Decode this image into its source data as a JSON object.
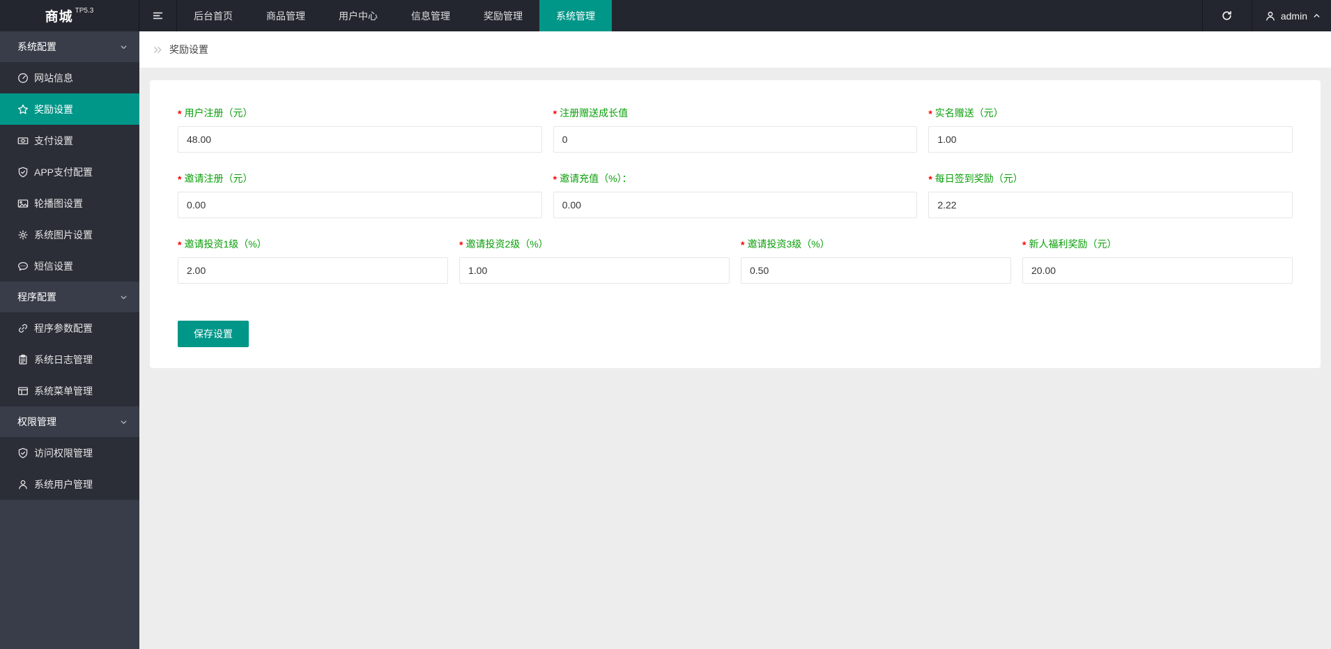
{
  "colors": {
    "accent": "#009688",
    "label_green": "#0a9f0a",
    "asterisk_red": "#ff0000"
  },
  "topbar": {
    "logo": "商城",
    "logo_version": "TP5.3",
    "nav": [
      {
        "label": "后台首页"
      },
      {
        "label": "商品管理"
      },
      {
        "label": "用户中心"
      },
      {
        "label": "信息管理"
      },
      {
        "label": "奖励管理"
      },
      {
        "label": "系统管理",
        "active": true
      }
    ],
    "username": "admin"
  },
  "breadcrumb": {
    "current": "奖励设置"
  },
  "sidebar": {
    "sections": [
      {
        "title": "系统配置",
        "items": [
          {
            "label": "网站信息",
            "icon": "gauge-icon"
          },
          {
            "label": "奖励设置",
            "icon": "star-icon",
            "active": true
          },
          {
            "label": "支付设置",
            "icon": "banknote-icon"
          },
          {
            "label": "APP支付配置",
            "icon": "shield-check-icon"
          },
          {
            "label": "轮播图设置",
            "icon": "image-icon"
          },
          {
            "label": "系统图片设置",
            "icon": "gear-icon"
          },
          {
            "label": "短信设置",
            "icon": "message-icon"
          }
        ]
      },
      {
        "title": "程序配置",
        "items": [
          {
            "label": "程序参数配置",
            "icon": "link-icon"
          },
          {
            "label": "系统日志管理",
            "icon": "clipboard-icon"
          },
          {
            "label": "系统菜单管理",
            "icon": "layout-icon"
          }
        ]
      },
      {
        "title": "权限管理",
        "items": [
          {
            "label": "访问权限管理",
            "icon": "shield-check-icon"
          },
          {
            "label": "系统用户管理",
            "icon": "user-icon"
          }
        ]
      }
    ]
  },
  "form": {
    "required_marker": "*",
    "rows": [
      {
        "fields": [
          {
            "label": "用户注册（元）",
            "value": "48.00"
          },
          {
            "label": "注册赠送成长值",
            "value": "0"
          },
          {
            "label": "实名赠送（元）",
            "value": "1.00"
          }
        ]
      },
      {
        "fields": [
          {
            "label": "邀请注册（元）",
            "value": "0.00"
          },
          {
            "label": "邀请充值（%）：",
            "value": "0.00"
          },
          {
            "label": "每日签到奖励（元）",
            "value": "2.22"
          }
        ]
      },
      {
        "fields": [
          {
            "label": "邀请投资1级（%）",
            "value": "2.00"
          },
          {
            "label": "邀请投资2级（%）",
            "value": "1.00"
          },
          {
            "label": "邀请投资3级（%）",
            "value": "0.50"
          },
          {
            "label": "新人福利奖励（元）",
            "value": "20.00"
          }
        ]
      }
    ],
    "save_label": "保存设置"
  }
}
